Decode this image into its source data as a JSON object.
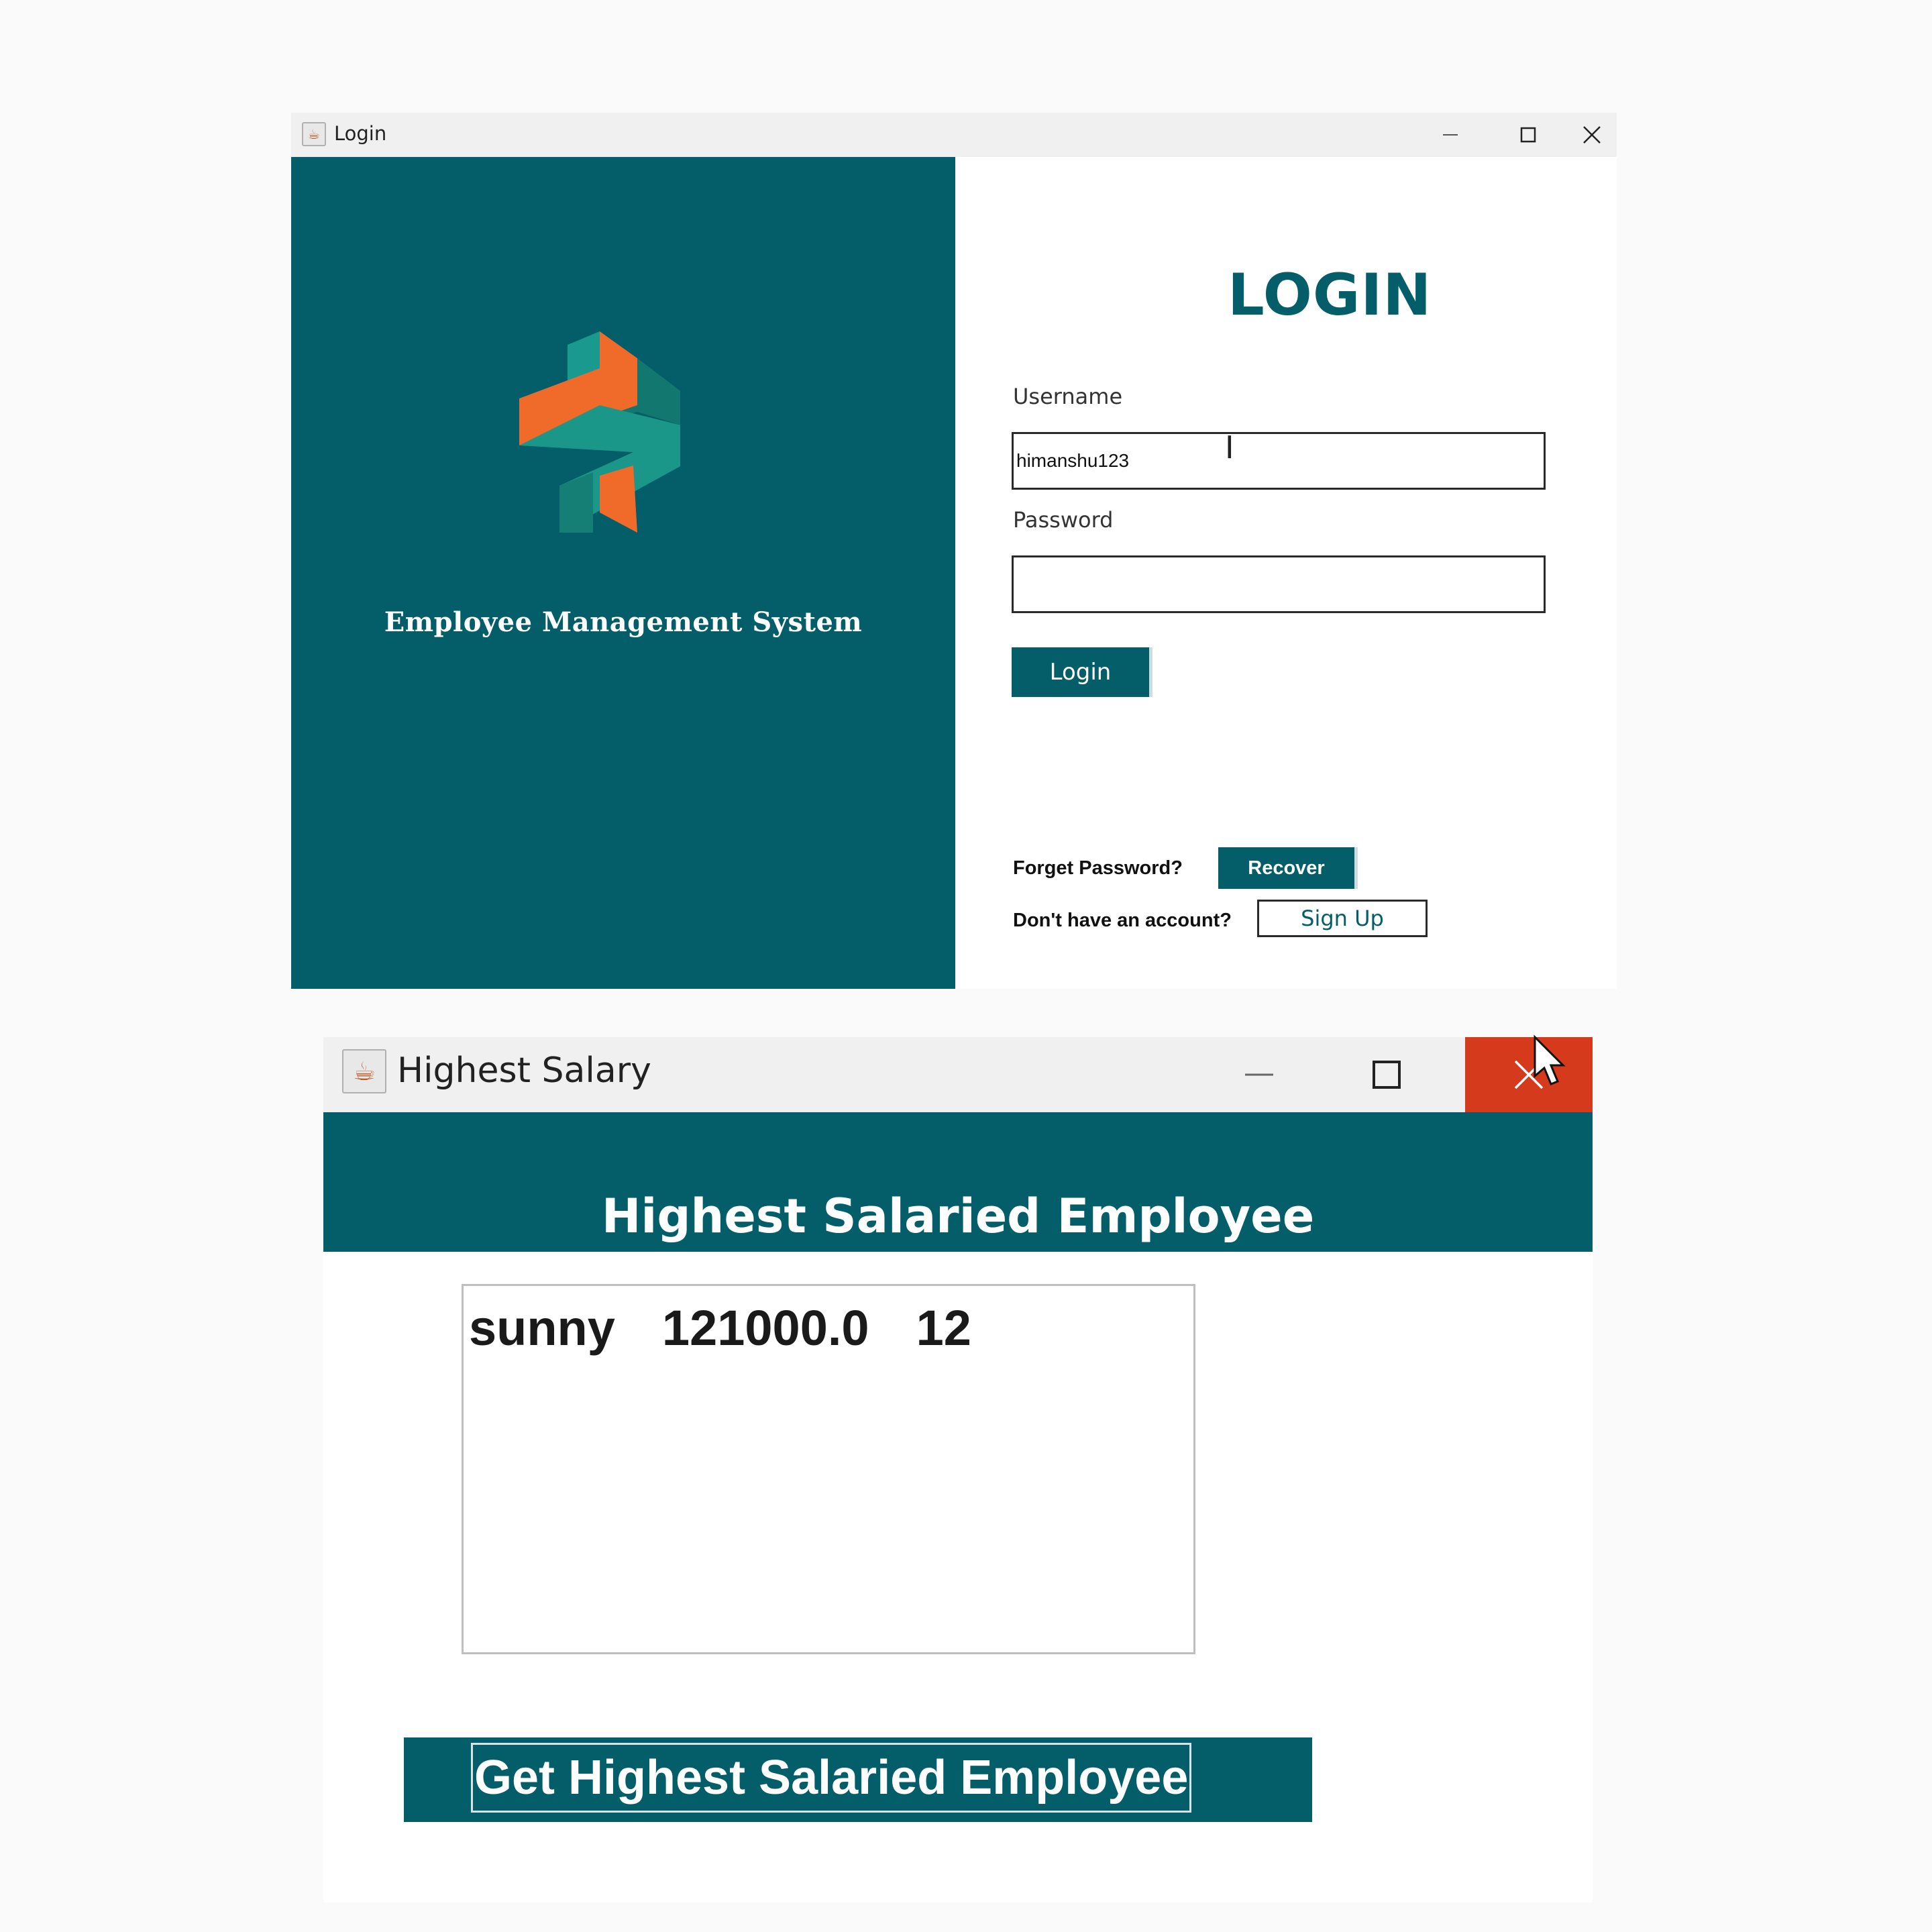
{
  "login_window": {
    "title": "Login",
    "brand": {
      "name": "Employee Management System"
    },
    "heading": "LOGIN",
    "username": {
      "label": "Username",
      "value": "himanshu123"
    },
    "password": {
      "label": "Password",
      "value": ""
    },
    "login_button": "Login",
    "forget_password": {
      "text": "Forget Password?",
      "button": "Recover"
    },
    "no_account": {
      "text": "Don't have an account?",
      "button": "Sign Up"
    }
  },
  "salary_window": {
    "title": "Highest Salary",
    "heading": "Highest Salaried Employee",
    "result": {
      "name": "sunny",
      "salary": "121000.0",
      "id": "12"
    },
    "button": "Get Highest Salaried Employee"
  },
  "colors": {
    "brand_teal": "#035e69",
    "brand_orange": "#f06a2a",
    "close_red": "#d63a1d"
  },
  "icons": [
    "java-app-icon",
    "minimize-icon",
    "maximize-icon",
    "close-icon",
    "text-cursor-icon",
    "mouse-pointer-icon",
    "company-logo"
  ]
}
